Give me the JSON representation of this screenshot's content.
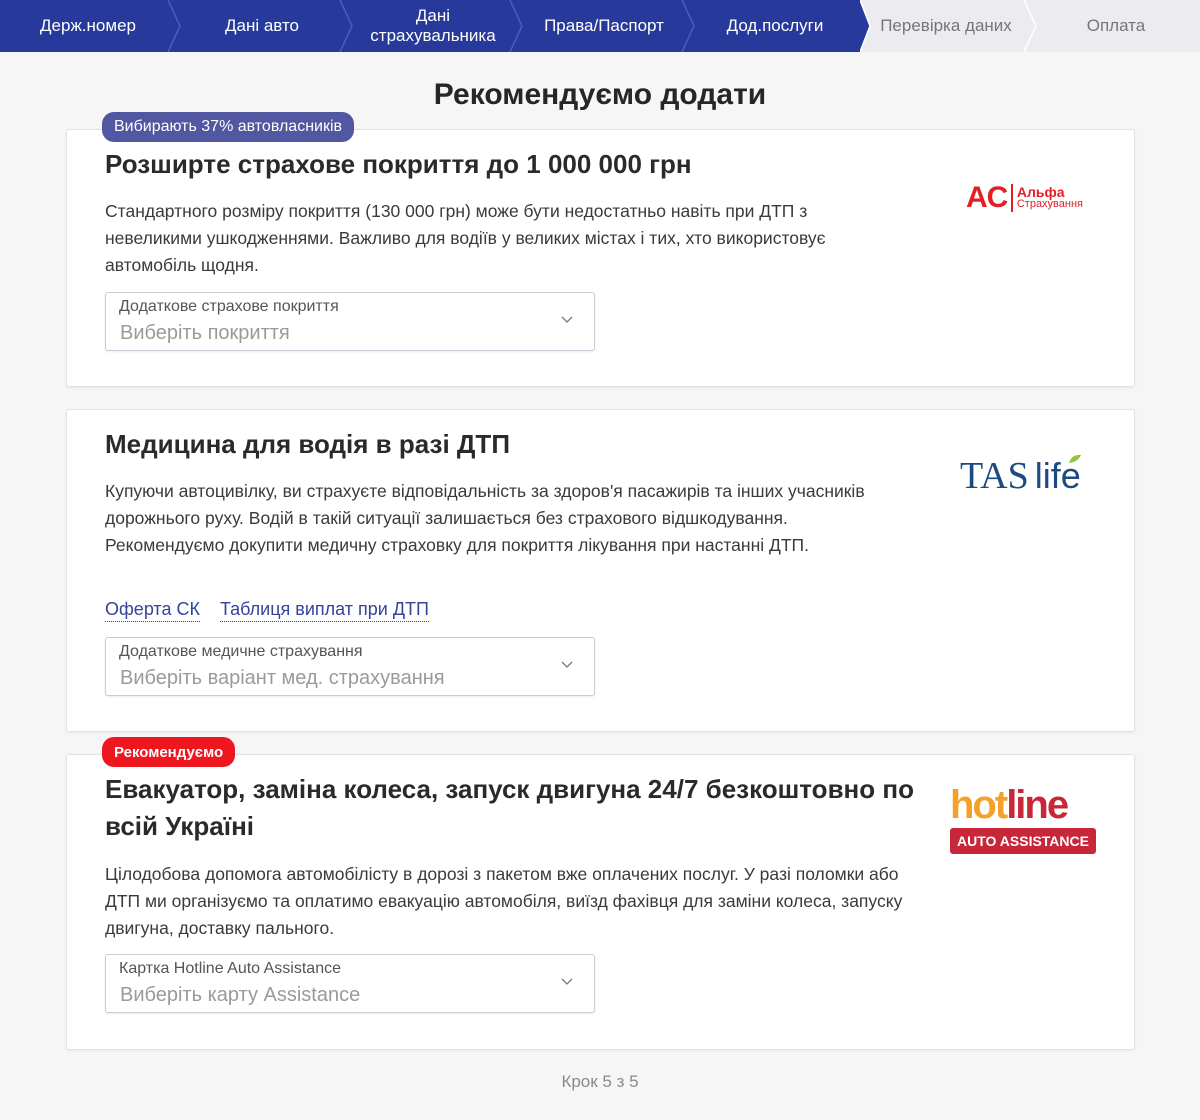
{
  "stepper": {
    "steps": [
      {
        "label": "Держ.номер",
        "state": "done"
      },
      {
        "label": "Дані авто",
        "state": "done"
      },
      {
        "label": "Дані страхувальника",
        "state": "done"
      },
      {
        "label": "Права/Паспорт",
        "state": "done"
      },
      {
        "label": "Дод.послуги",
        "state": "current"
      },
      {
        "label": "Перевірка даних",
        "state": "todo"
      },
      {
        "label": "Оплата",
        "state": "todo"
      }
    ]
  },
  "page_title": "Рекомендуємо додати",
  "cards": [
    {
      "badge": "Вибирають 37% автовласників",
      "title": "Розширте страхове покриття до 1 000 000 грн",
      "description": "Стандартного розміру покриття (130 000 грн) може бути недостатньо навіть при ДТП з невеликими ушкодженнями. Важливо для водіїв у великих містах і тих, хто використовує автомобіль щодня.",
      "select": {
        "label": "Додаткове страхове покриття",
        "placeholder": "Виберіть покриття"
      },
      "logo": {
        "abbr": "AC",
        "line1": "Альфа",
        "line2": "Страхування"
      }
    },
    {
      "title": "Медицина для водія в разі ДТП",
      "description": "Купуючи автоцивілку, ви страхуєте відповідальність за здоров'я пасажирів та інших учасників дорожнього руху. Водій в такій ситуації залишається без страхового відшкодування. Рекомендуємо докупити медичну страховку для покриття лікування при настанні ДТП.",
      "links": [
        "Оферта СК",
        "Таблиця виплат при ДТП"
      ],
      "select": {
        "label": "Додаткове медичне страхування",
        "placeholder": "Виберіть варіант мед. страхування"
      },
      "logo": {
        "part1": "TAS",
        "part2": "life"
      }
    },
    {
      "badge": "Рекомендуємо",
      "title": "Евакуатор, заміна колеса, запуск двигуна 24/7 безкоштовно по всій Україні",
      "description": "Цілодобова допомога автомобілісту в дорозі з пакетом вже оплачених послуг. У разі поломки або ДТП ми організуємо та оплатимо евакуацію автомобіля, виїзд фахівця для заміни колеса, запуску двигуна, доставку пального.",
      "select": {
        "label": "Картка Hotline Auto Assistance",
        "placeholder": "Виберіть карту Assistance"
      },
      "logo": {
        "part1": "hot",
        "part2": "line",
        "sub": "AUTO ASSISTANCE"
      }
    }
  ],
  "footer": "Крок 5 з 5",
  "colors": {
    "primary": "#273a9c",
    "badge_blue": "#5157a0",
    "badge_red": "#ef1620",
    "link": "#34449a"
  }
}
